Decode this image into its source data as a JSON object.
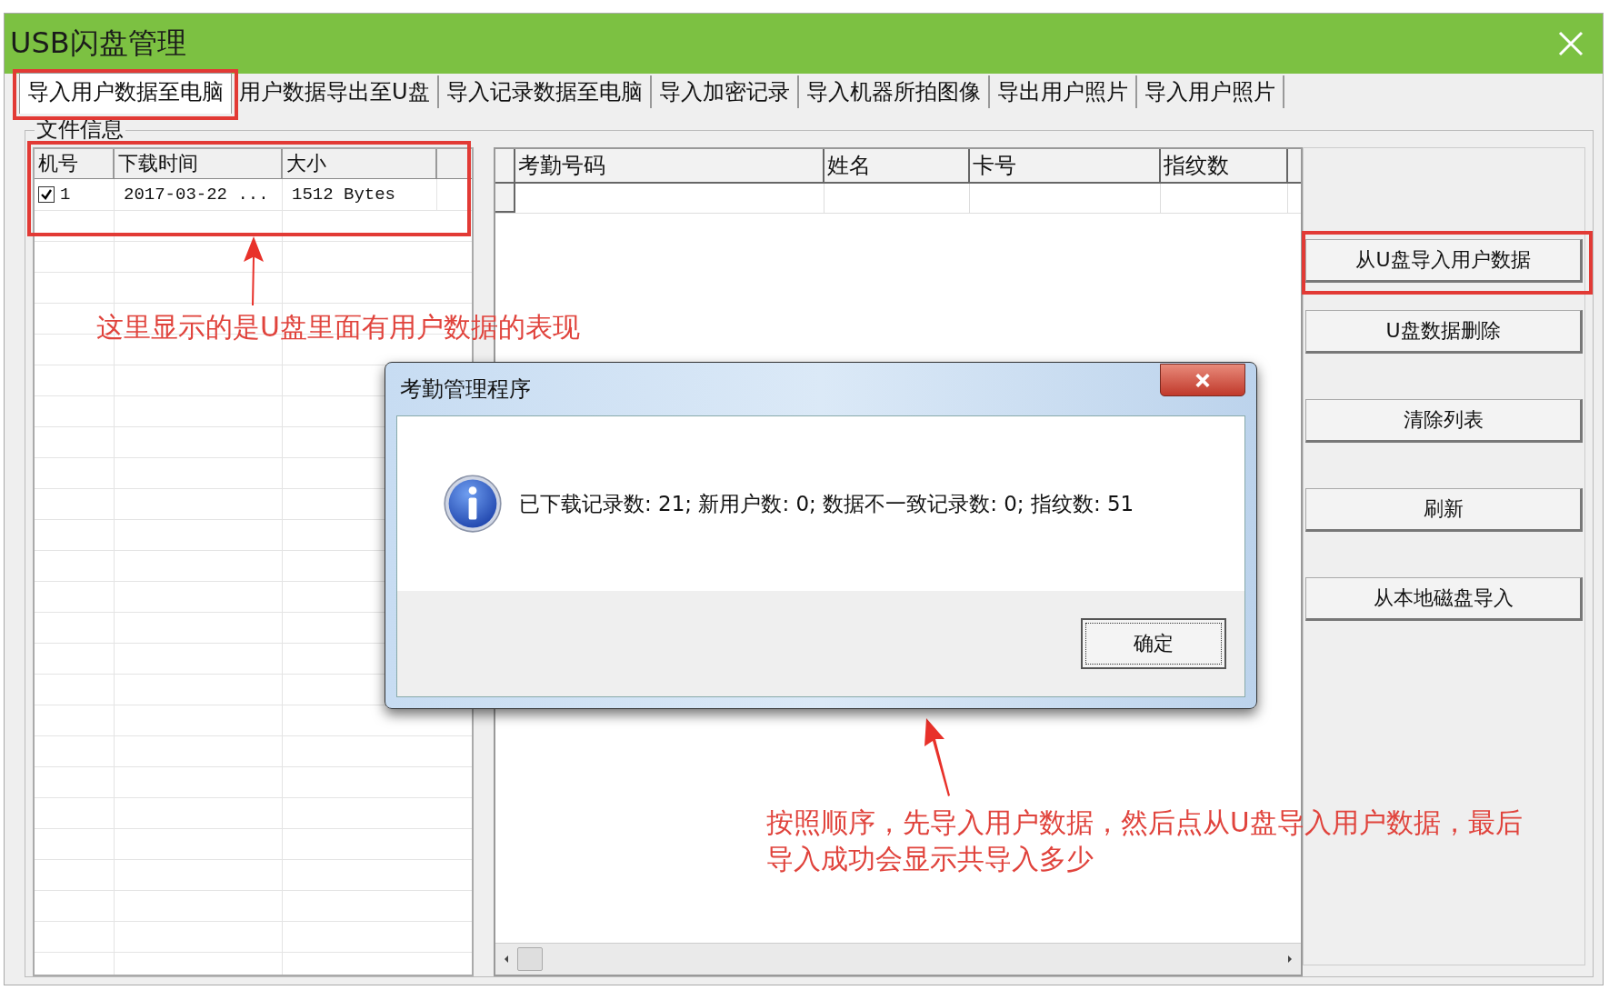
{
  "window": {
    "title": "USB闪盘管理"
  },
  "tabs": [
    {
      "label": "导入用户数据至电脑",
      "selected": true
    },
    {
      "label": "用户数据导出至U盘",
      "selected": false
    },
    {
      "label": "导入记录数据至电脑",
      "selected": false
    },
    {
      "label": "导入加密记录",
      "selected": false
    },
    {
      "label": "导入机器所拍图像",
      "selected": false
    },
    {
      "label": "导出用户照片",
      "selected": false
    },
    {
      "label": "导入用户照片",
      "selected": false
    }
  ],
  "group_label": "文件信息",
  "file_table": {
    "columns": [
      "机号",
      "下载时间",
      "大小"
    ],
    "rows": [
      {
        "checked": true,
        "cells": [
          "1",
          "2017-03-22 ...",
          "1512 Bytes"
        ]
      }
    ]
  },
  "user_table": {
    "columns": [
      "考勤号码",
      "姓名",
      "卡号",
      "指纹数"
    ]
  },
  "buttons": [
    {
      "label": "从U盘导入用户数据"
    },
    {
      "label": "U盘数据删除"
    },
    {
      "label": "清除列表"
    },
    {
      "label": "刷新"
    },
    {
      "label": "从本地磁盘导入"
    }
  ],
  "dialog": {
    "title": "考勤管理程序",
    "message": "已下载记录数: 21; 新用户数: 0; 数据不一致记录数: 0; 指纹数: 51",
    "ok_button": "确定"
  },
  "annotations": [
    {
      "lines": [
        "这里显示的是U盘里面有用户数据的表现"
      ]
    },
    {
      "lines": [
        "按照顺序，先导入用户数据，然后点从U盘导入用户数据，最后",
        "导入成功会显示共导入多少"
      ]
    }
  ]
}
